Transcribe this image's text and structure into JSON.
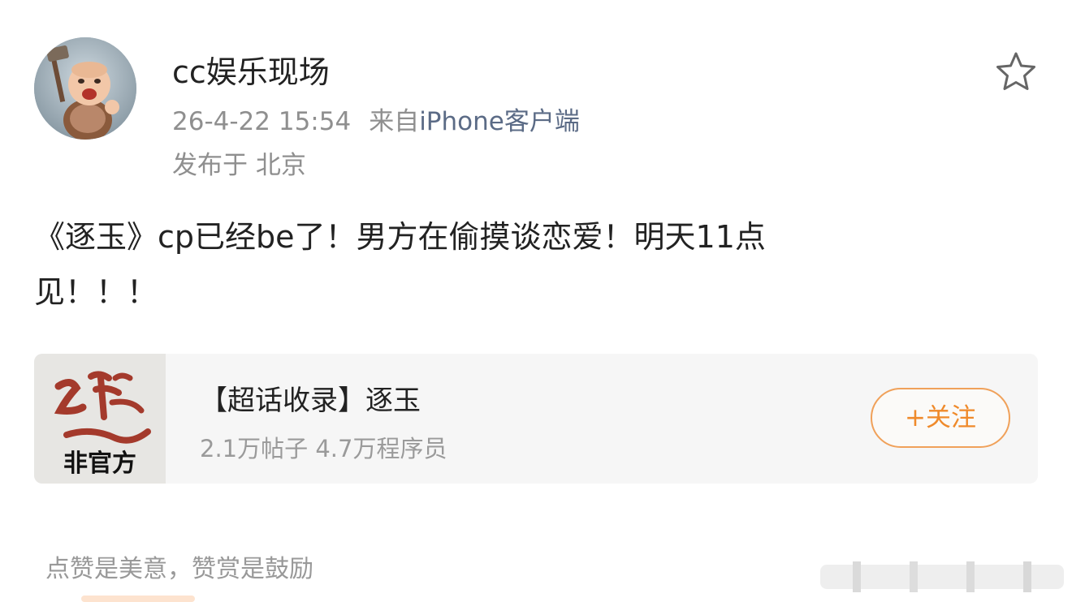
{
  "post": {
    "author": "cc娱乐现场",
    "time": "26-4-22 15:54",
    "source_prefix": "来自",
    "source": "iPhone客户端",
    "location": "发布于 北京",
    "text": "《逐玉》cp已经be了！男方在偷摸谈恋爱！明天11点\n见！！！",
    "star_icon": "star-outline-icon"
  },
  "card": {
    "thumb_tag": "非官方",
    "title": "【超话收录】逐玉",
    "subtitle": "2.1万帖子 4.7万程序员",
    "follow_label": "+关注"
  },
  "footer": {
    "reward_text": "点赞是美意，赞赏是鼓励"
  },
  "colors": {
    "accent_orange": "#ef8a2b",
    "source_blue": "#5b6b86",
    "meta_gray": "#8f8f8f"
  }
}
